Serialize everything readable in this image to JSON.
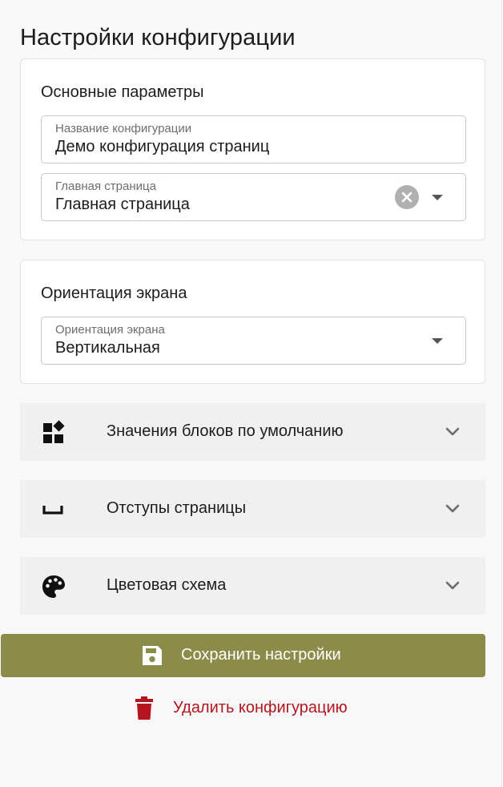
{
  "page": {
    "title": "Настройки конфигурации"
  },
  "basic": {
    "title": "Основные параметры",
    "name_field": {
      "label": "Название конфигурации",
      "value": "Демо конфигурация страниц"
    },
    "home_field": {
      "label": "Главная страница",
      "value": "Главная страница"
    }
  },
  "orientation": {
    "title": "Ориентация экрана",
    "field": {
      "label": "Ориентация экрана",
      "value": "Вертикальная"
    }
  },
  "accordions": [
    {
      "label": "Значения блоков по умолчанию",
      "icon": "widgets-icon"
    },
    {
      "label": "Отступы страницы",
      "icon": "space-bar-icon"
    },
    {
      "label": "Цветовая схема",
      "icon": "palette-icon"
    }
  ],
  "actions": {
    "save_label": "Сохранить настройки",
    "delete_label": "Удалить конфигурацию"
  },
  "colors": {
    "accent": "#8b8c49",
    "danger": "#b3161e",
    "accordion_bg": "#f0f0f0"
  }
}
